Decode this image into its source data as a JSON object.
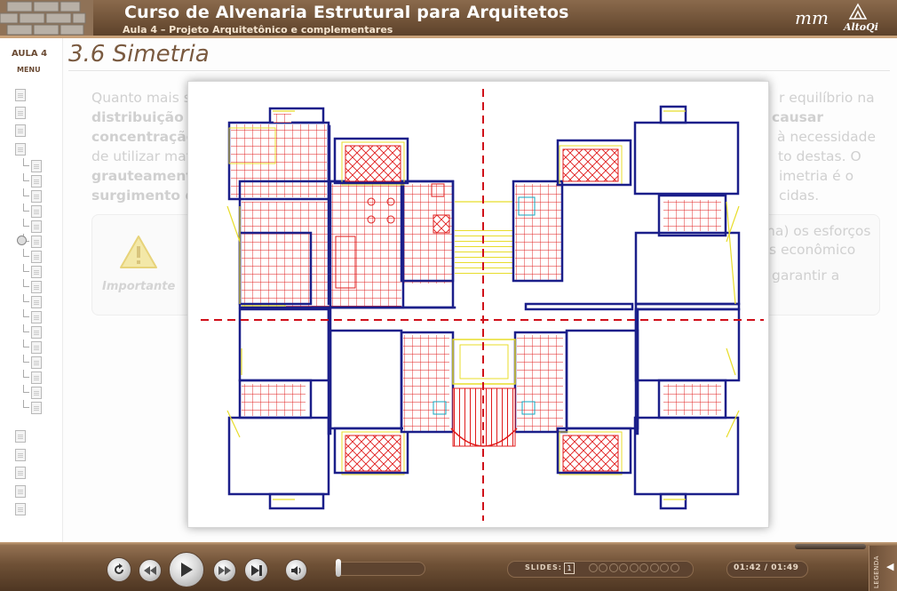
{
  "header": {
    "course_title": "Curso de Alvenaria Estrutural para Arquitetos",
    "subtitle": "Aula 4 – Projeto Arquitetônico e complementares",
    "logo_left_text": "mm",
    "logo_right_text": "AltoQi"
  },
  "sidebar": {
    "aula_label": "AULA 4",
    "menu_label": "MENU"
  },
  "content": {
    "page_title": "3.6 Simetria",
    "paragraph_lines_left": [
      "Quanto mais s",
      "distribuição d",
      "concentração",
      "de utilizar mat",
      "grauteamento",
      "surgimento d"
    ],
    "paragraph_lines_right": [
      "r equilíbrio na",
      "causar",
      "à necessidade",
      "to destas. O",
      "imetria é o",
      "cidas."
    ],
    "info_lines_right": [
      "na) os esforços",
      "s econômico",
      "garantir a"
    ],
    "importante_label": "Importante"
  },
  "figure": {
    "description_name": "floor-plan-simetria",
    "colors": {
      "walls": "#1b1f8a",
      "tiles": "#e01b1b",
      "fixtures": "#e8dd2a",
      "axis": "#d0101a"
    }
  },
  "player": {
    "slides_label": "SLIDES:",
    "current_slide": "1",
    "slide_count": 10,
    "time": "01:42 / 01:49",
    "legenda_label": "LEGENDA",
    "volume_level": 0.02
  },
  "icons": {
    "replay": "replay-icon",
    "rewind": "rewind-icon",
    "play": "play-icon",
    "forward": "fast-forward-icon",
    "end": "skip-end-icon",
    "volume": "volume-icon",
    "warning": "warning-icon"
  }
}
